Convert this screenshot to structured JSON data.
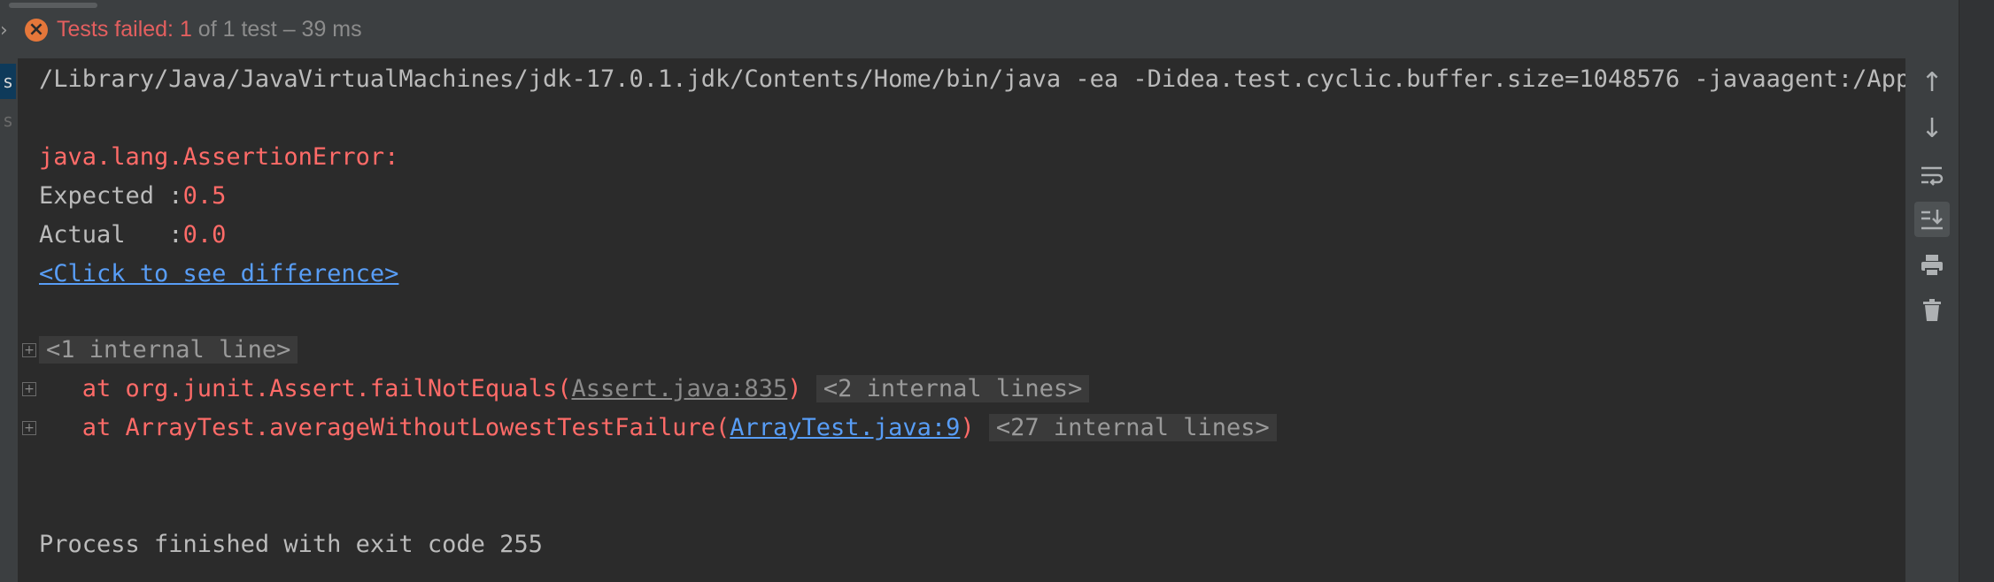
{
  "status": {
    "prefix": "Tests failed: 1",
    "suffix": " of 1 test – 39 ms"
  },
  "gutter": {
    "tab1": "s",
    "tab2": "s"
  },
  "console": {
    "command": "/Library/Java/JavaVirtualMachines/jdk-17.0.1.jdk/Contents/Home/bin/java -ea -Didea.test.cyclic.buffer.size=1048576 -javaagent:/Appli",
    "error": "java.lang.AssertionError:",
    "expected_label": "Expected :",
    "expected_value": "0.5",
    "actual_label": "Actual   :",
    "actual_value": "0.0",
    "diff_link": "<Click to see difference>",
    "internal_1": "<1 internal line>",
    "trace1_prefix": "   at org.junit.Assert.failNotEquals(",
    "trace1_link": "Assert.java:835",
    "trace1_suffix": ")",
    "internal_2": "<2 internal lines>",
    "trace2_prefix": "   at ArrayTest.averageWithoutLowestTestFailure(",
    "trace2_link": "ArrayTest.java:9",
    "trace2_suffix": ")",
    "internal_27": "<27 internal lines>",
    "exit": "Process finished with exit code 255"
  },
  "toolbar": {
    "icons": [
      "arrow-up-icon",
      "arrow-down-icon",
      "soft-wrap-icon",
      "scroll-to-end-icon",
      "print-icon",
      "trash-icon"
    ]
  }
}
